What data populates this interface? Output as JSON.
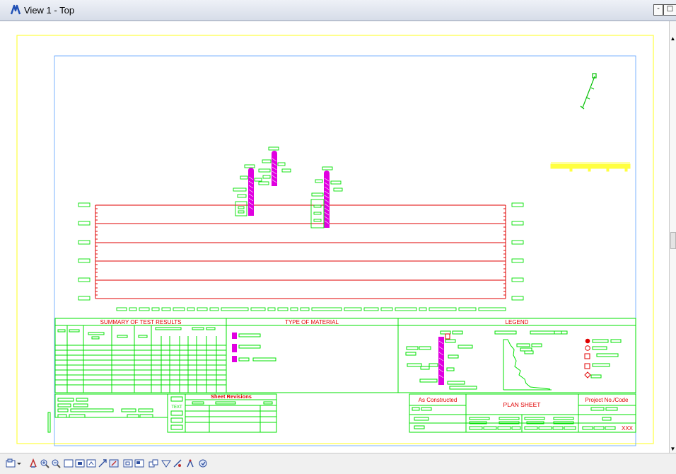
{
  "window": {
    "title": "View 1 - Top",
    "minimize_glyph": "-",
    "restore_glyph": "□"
  },
  "drawing": {
    "summary_title": "SUMMARY OF TEST RESULTS",
    "material_title": "TYPE OF MATERIAL",
    "legend_title": "LEGEND",
    "sheet_revisions": "Sheet Revisions",
    "as_constructed": "As Constructed",
    "plan_sheet": "PLAN SHEET",
    "project_no": "Project No./Code",
    "sheet_number": "XXX",
    "sheet_badge": "TEXT",
    "colors": {
      "linework": "#00e000",
      "profile": "#e00000",
      "boring": "#e000e0",
      "border": "#ffff40",
      "north": "#00c000",
      "titles": "#e00000"
    }
  },
  "toolbar": {
    "icons": [
      "view-attributes-icon",
      "dropdown-arrow-icon",
      "update-view-icon",
      "zoom-in-icon",
      "zoom-out-icon",
      "window-area-icon",
      "fit-view-icon",
      "rotate-view-icon",
      "pan-view-icon",
      "view-previous-icon",
      "view-next-icon",
      "copy-view-icon",
      "camera-icon",
      "clip-volume-icon",
      "view-display-icon",
      "clip-mask-icon",
      "view-settings-icon"
    ]
  }
}
